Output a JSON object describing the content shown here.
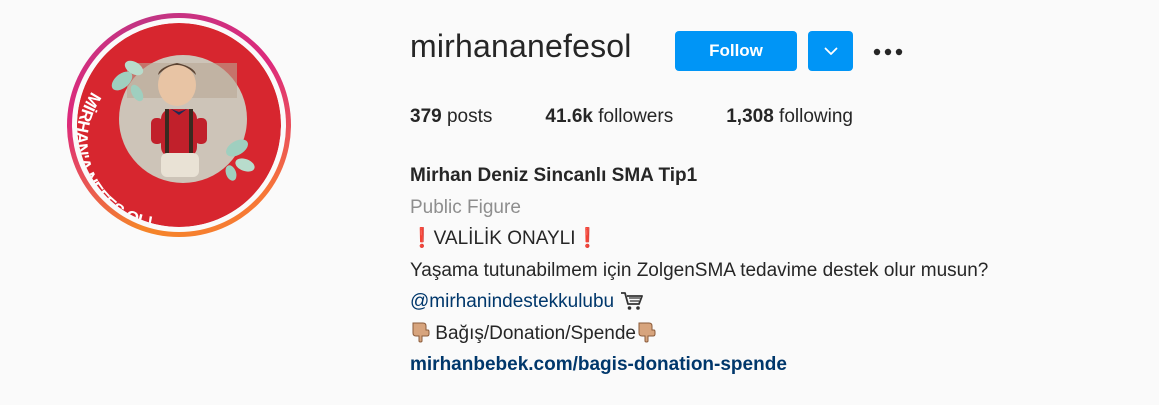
{
  "profile": {
    "username": "mirhananefesol",
    "follow_label": "Follow",
    "stats": {
      "posts_count": "379",
      "posts_label": "posts",
      "followers_count": "41.6k",
      "followers_label": "followers",
      "following_count": "1,308",
      "following_label": "following"
    },
    "full_name": "Mirhan Deniz Sincanlı SMA Tip1",
    "category": "Public Figure",
    "bio": {
      "line1": "VALİLİK ONAYLI",
      "line2": "Yaşama tutunabilmem için ZolgenSMA tedavime destek olur musun?",
      "mention": "@mirhanindestekkulubu",
      "donation": "Bağış/Donation/Spende",
      "website": "mirhanbebek.com/bagis-donation-spende"
    },
    "avatar_banner_text": "MİRHAN'A NEFES OL!"
  },
  "icons": {
    "dropdown": "chevron-down-icon",
    "more": "more-options-icon",
    "exclamation": "red-exclamation-icon",
    "cart": "shopping-cart-icon",
    "pointing": "pointing-down-hand-icon"
  },
  "colors": {
    "primary_blue": "#0095f6",
    "link_blue": "#00376b",
    "muted_gray": "#8e8e8e",
    "avatar_banner_red": "#d7262f"
  }
}
